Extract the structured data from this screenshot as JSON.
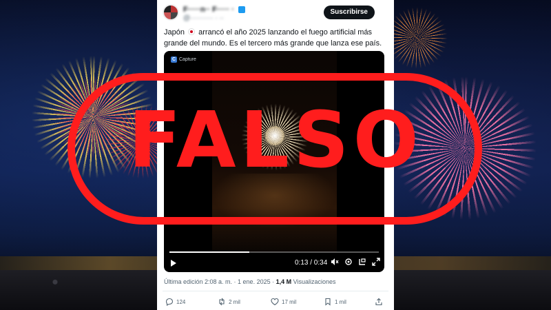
{
  "tweet": {
    "display_name": "F·····n·· F····· ·",
    "handle": "@·········· · ··",
    "follow_label": "Suscribirse",
    "text_part1": "Japón",
    "text_part2": "arrancó el año 2025 lanzando el fuego artificial más grande del mundo. Es el tercero más grande que lanza ese país.",
    "flag_icon": "japan-flag-icon",
    "video": {
      "watermark": "Capture",
      "time": "0:13 / 0:34",
      "progress": 0.38
    },
    "meta": {
      "edited": "Última edición 2:08 a. m. · 1 ene. 2025 ·",
      "views_count": "1,4 M",
      "views_label": "Visualizaciones"
    },
    "actions": {
      "replies": "124",
      "reposts": "2 mil",
      "likes": "17 mil",
      "bookmarks": "1 mil"
    }
  },
  "overlay": {
    "stamp_text": "FALSO",
    "stamp_color": "#ff1d1d"
  }
}
